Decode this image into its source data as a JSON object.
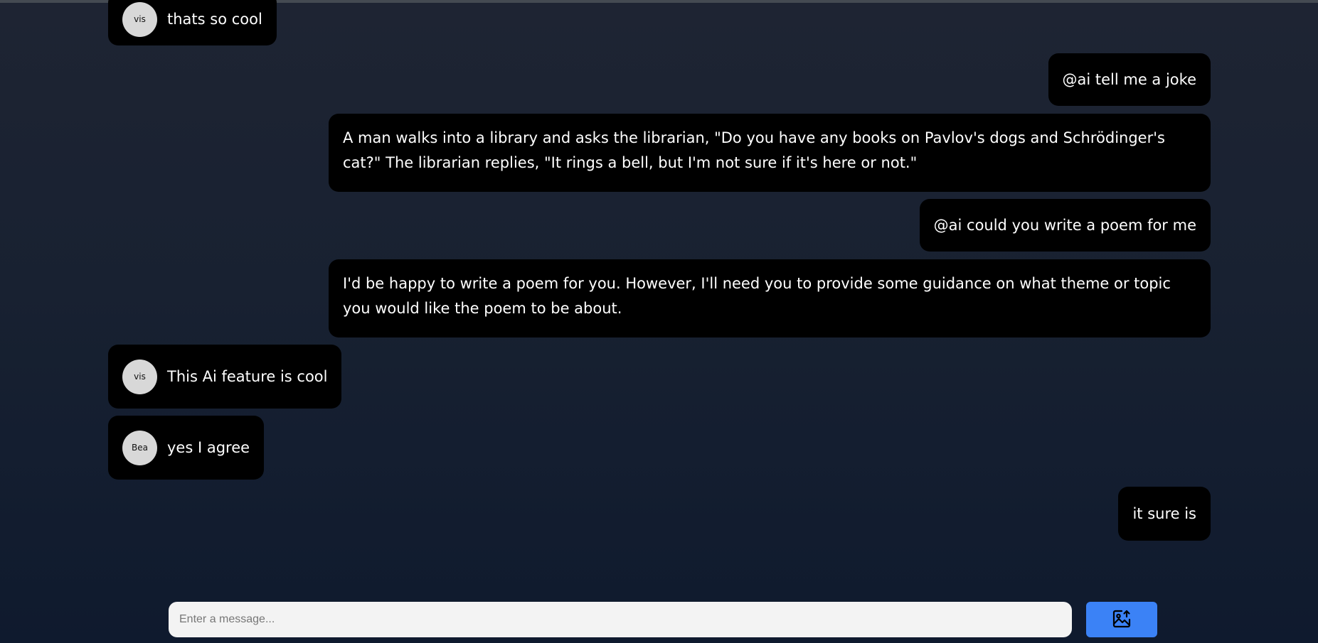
{
  "messages": [
    {
      "side": "left",
      "avatar": "vis",
      "text": "thats so cool"
    },
    {
      "side": "right",
      "text": "@ai tell me a joke"
    },
    {
      "side": "right",
      "text": "A man walks into a library and asks the librarian, \"Do you have any books on Pavlov's dogs and Schrödinger's cat?\" The librarian replies, \"It rings a bell, but I'm not sure if it's here or not.\""
    },
    {
      "side": "right",
      "text": "@ai could you write a poem for me"
    },
    {
      "side": "right",
      "text": "I'd be happy to write a poem for you. However, I'll need you to provide some guidance on what theme or topic you would like the poem to be about."
    },
    {
      "side": "left",
      "avatar": "vis",
      "text": "This Ai feature is cool"
    },
    {
      "side": "left",
      "avatar": "Bea",
      "text": "yes I agree"
    },
    {
      "side": "right",
      "text": "it sure is"
    }
  ],
  "composer": {
    "placeholder": "Enter a message...",
    "value": ""
  },
  "upload_button": {
    "icon": "image-upload-icon"
  },
  "colors": {
    "bubble": "#000000",
    "avatar_bg": "#d8d8d8",
    "accent": "#3b82f6",
    "input_bg": "#f3f3f3"
  }
}
